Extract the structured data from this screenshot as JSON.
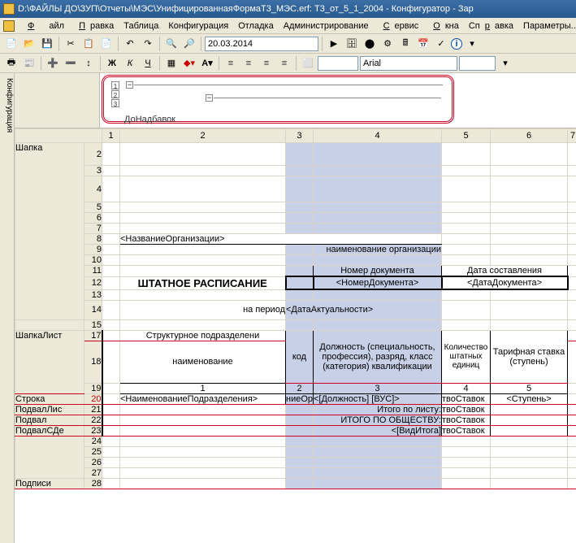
{
  "title": "D:\\ФАЙЛЫ ДО\\ЗУП\\Отчеты\\МЭС\\УнифицированнаяФормаТ3_МЭС.erf: Т3_от_5_1_2004 - Конфигуратор - Зар",
  "menus": [
    "Файл",
    "Правка",
    "Таблица",
    "Конфигурация",
    "Отладка",
    "Администрирование",
    "Сервис",
    "Окна",
    "Справка",
    "Параметры..."
  ],
  "date": "20.03.2014",
  "font": "Arial",
  "font_size": "",
  "sidebar_tab": "Конфигурация",
  "outline_label": "ДоНадбавок",
  "col_headers": [
    "1",
    "2",
    "3",
    "4",
    "5",
    "6",
    "7"
  ],
  "sections": {
    "shapka": "Шапка",
    "shapka_lista": "ШапкаЛист",
    "stroka": "Строка",
    "podval_list": "ПодвалЛис",
    "podval": "Подвал",
    "podval_sde": "ПодвалСДе",
    "podpisi": "Подписи"
  },
  "cells": {
    "org_name": "<НазваниеОрганизации>",
    "org_small": "наименование организации",
    "doc_num_label": "Номер документа",
    "doc_date_label": "Дата составления",
    "doc_num": "<НомерДокумента>",
    "doc_date": "<ДатаДокумента>",
    "staff_title": "ШТАТНОЕ РАСПИСАНИЕ",
    "period_label": "на период",
    "actuality": "<ДатаАктуальности>",
    "struct_label": "Структурное  подразделени",
    "position_label": "Должность (специальность, профессия), разряд, класс (категория) квалификации",
    "qty_label": "Количество штатных единиц",
    "rate_label": "Тарифная ставка (ступень)",
    "name_label": "наименование",
    "code_label": "код",
    "col_nums": [
      "1",
      "2",
      "3",
      "4",
      "5"
    ],
    "row_struct_name": "<НаименованиеПодразделения>",
    "row_code": "ниеОрга",
    "row_position": "<[Должность] [ВУС]>",
    "row_qty": "твоСтавок",
    "row_rate": "<Ступень>",
    "total_sheet": "Итого по листу:",
    "total_company": "ИТОГО ПО ОБЩЕСТВУ:",
    "total_type": "<[ВидИтога]",
    "qty2": "твоСтавок",
    "qty3": "твоСтавок",
    "qty4": "твоСтавок"
  },
  "row_nums": [
    2,
    3,
    4,
    5,
    6,
    7,
    8,
    9,
    10,
    11,
    12,
    13,
    14,
    15,
    17,
    18,
    19,
    20,
    21,
    22,
    23,
    24,
    25,
    26,
    27,
    28
  ]
}
